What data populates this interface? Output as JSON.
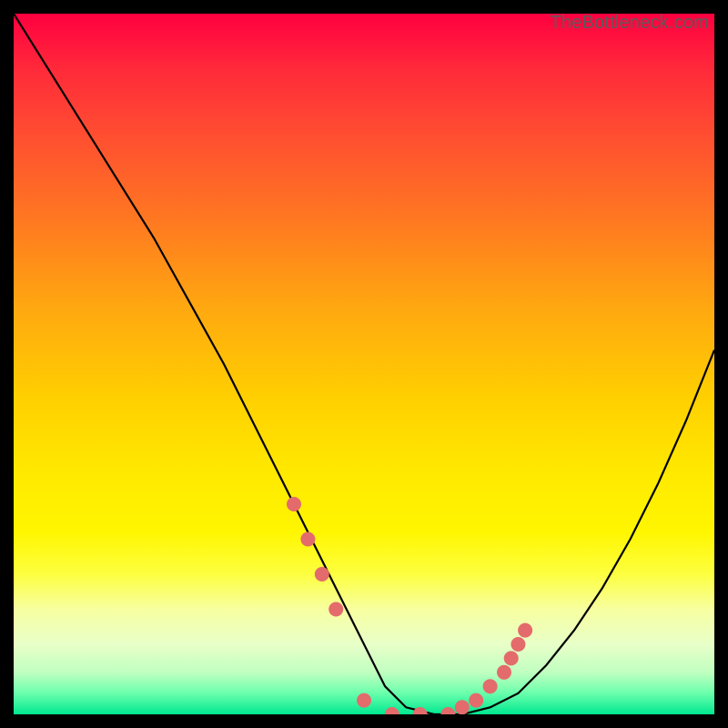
{
  "watermark": "TheBottleneck.com",
  "chart_data": {
    "type": "line",
    "title": "",
    "xlabel": "",
    "ylabel": "",
    "xlim": [
      0,
      100
    ],
    "ylim": [
      0,
      100
    ],
    "series": [
      {
        "name": "curve",
        "x": [
          0,
          5,
          10,
          15,
          20,
          25,
          30,
          35,
          40,
          45,
          50,
          53,
          56,
          60,
          64,
          68,
          72,
          76,
          80,
          84,
          88,
          92,
          96,
          100
        ],
        "values": [
          100,
          92,
          84,
          76,
          68,
          59,
          50,
          40,
          30,
          20,
          10,
          4,
          1,
          0,
          0,
          1,
          3,
          7,
          12,
          18,
          25,
          33,
          42,
          52
        ]
      }
    ],
    "markers": {
      "name": "highlight-points",
      "color": "#e46b6b",
      "x": [
        40,
        42,
        44,
        46,
        50,
        54,
        58,
        62,
        64,
        66,
        68,
        70,
        71,
        72,
        73
      ],
      "values": [
        30,
        25,
        20,
        15,
        2,
        0,
        0,
        0,
        1,
        2,
        4,
        6,
        8,
        10,
        12
      ]
    }
  }
}
